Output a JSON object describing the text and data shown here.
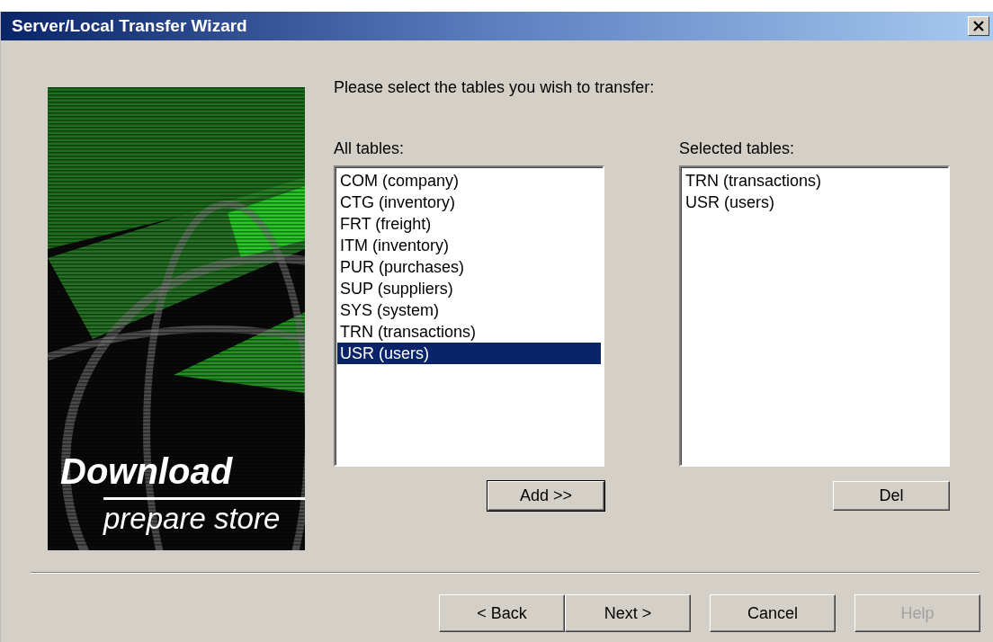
{
  "window": {
    "title": "Server/Local Transfer Wizard"
  },
  "banner": {
    "title": "Download",
    "subtitle": "prepare store"
  },
  "instruction": "Please select the tables you wish to transfer:",
  "all_tables": {
    "label": "All tables:",
    "items": [
      {
        "text": "COM (company)",
        "selected": false
      },
      {
        "text": "CTG (inventory)",
        "selected": false
      },
      {
        "text": "FRT (freight)",
        "selected": false
      },
      {
        "text": "ITM (inventory)",
        "selected": false
      },
      {
        "text": "PUR (purchases)",
        "selected": false
      },
      {
        "text": "SUP (suppliers)",
        "selected": false
      },
      {
        "text": "SYS (system)",
        "selected": false
      },
      {
        "text": "TRN (transactions)",
        "selected": false
      },
      {
        "text": "USR (users)",
        "selected": true
      }
    ],
    "button": {
      "label": "Add >>",
      "default": true
    }
  },
  "selected_tables": {
    "label": "Selected tables:",
    "items": [
      {
        "text": "TRN (transactions)",
        "selected": false
      },
      {
        "text": "USR (users)",
        "selected": false
      }
    ],
    "button": {
      "label": "Del",
      "default": false
    }
  },
  "buttons": [
    {
      "label": "< Back",
      "disabled": false
    },
    {
      "label": "Next >",
      "disabled": false
    },
    {
      "label": "Cancel",
      "disabled": false
    },
    {
      "label": "Help",
      "disabled": true
    }
  ]
}
